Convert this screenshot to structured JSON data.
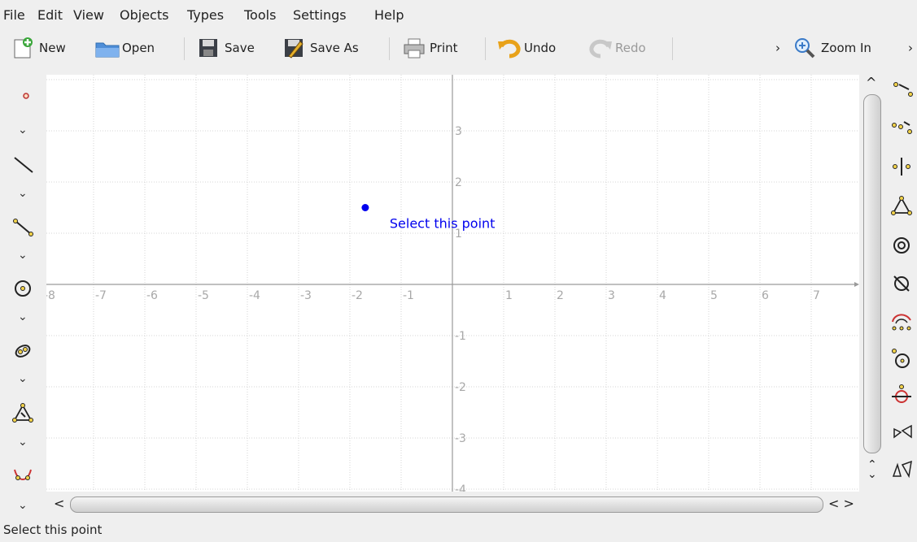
{
  "menubar": {
    "items": [
      {
        "label": "File"
      },
      {
        "label": "Edit"
      },
      {
        "label": "View"
      },
      {
        "label": "Objects"
      },
      {
        "label": "Types"
      },
      {
        "label": "Tools"
      },
      {
        "label": "Settings"
      },
      {
        "label": "Help"
      }
    ]
  },
  "toolbar": {
    "new_label": "New",
    "open_label": "Open",
    "save_label": "Save",
    "saveas_label": "Save As",
    "print_label": "Print",
    "undo_label": "Undo",
    "redo_label": "Redo",
    "overflow_glyph": "›",
    "zoomin_label": "Zoom In",
    "overflow2_glyph": "›"
  },
  "canvas": {
    "x_ticks": [
      "-8",
      "-7",
      "-6",
      "-5",
      "-4",
      "-3",
      "-2",
      "-1",
      "1",
      "2",
      "3",
      "4",
      "5",
      "6",
      "7"
    ],
    "y_ticks": [
      "3",
      "2",
      "1",
      "-1",
      "-2",
      "-3",
      "-4"
    ],
    "point": {
      "x": -1.7,
      "y": 1.5,
      "color": "#0000ee"
    },
    "point_label": "Select this point"
  },
  "scroll": {
    "up": "^",
    "down": "⌄",
    "updown_up": "⌃",
    "updown_down": "⌄",
    "left": "<",
    "right_pair": "< >"
  },
  "left_tools": {
    "chevron": "⌄",
    "icons": [
      "point-tool-icon",
      "line-tool-icon",
      "segment-tool-icon",
      "circle-tool-icon",
      "conic-tool-icon",
      "polygon-tool-icon",
      "curve-tool-icon"
    ]
  },
  "status": {
    "text": "Select this point"
  },
  "colors": {
    "accent": "#0000ee",
    "grid": "#d4d4d4",
    "axis": "#9a9a9a"
  }
}
